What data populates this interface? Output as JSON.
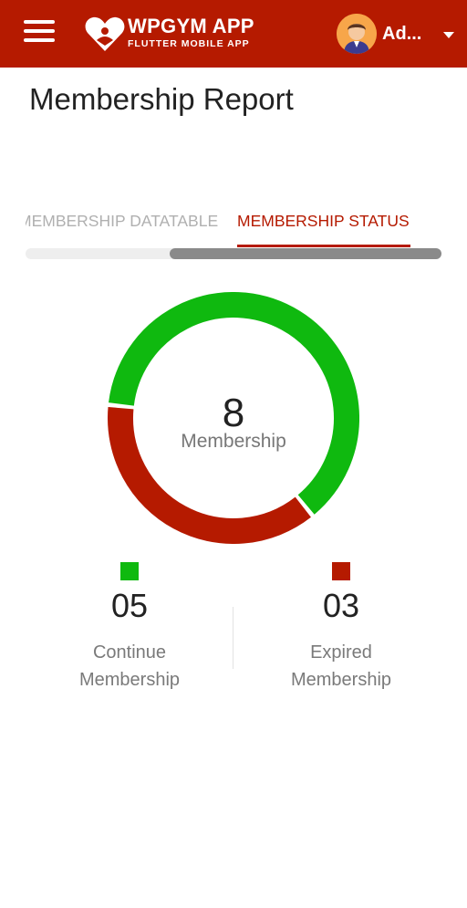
{
  "appbar": {
    "brand_title": "WPGYM APP",
    "brand_subtitle": "FLUTTER MOBILE APP",
    "user_name": "Ad...",
    "bg_color": "#b51a00"
  },
  "page": {
    "title": "Membership Report"
  },
  "tabs": [
    {
      "label": "MEMBERSHIP DATATABLE",
      "active": false
    },
    {
      "label": "MEMBERSHIP STATUS",
      "active": true
    }
  ],
  "chart_data": {
    "type": "pie",
    "subtype": "donut",
    "center_value": "8",
    "center_label": "Membership",
    "slices": [
      {
        "name": "Continue Membership",
        "value": 5,
        "color": "#0fb90f"
      },
      {
        "name": "Expired Membership",
        "value": 3,
        "color": "#b51a00"
      }
    ]
  },
  "legend": [
    {
      "value": "05",
      "label_line1": "Continue",
      "label_line2": "Membership",
      "color": "#0fb90f"
    },
    {
      "value": "03",
      "label_line1": "Expired",
      "label_line2": "Membership",
      "color": "#b51a00"
    }
  ]
}
